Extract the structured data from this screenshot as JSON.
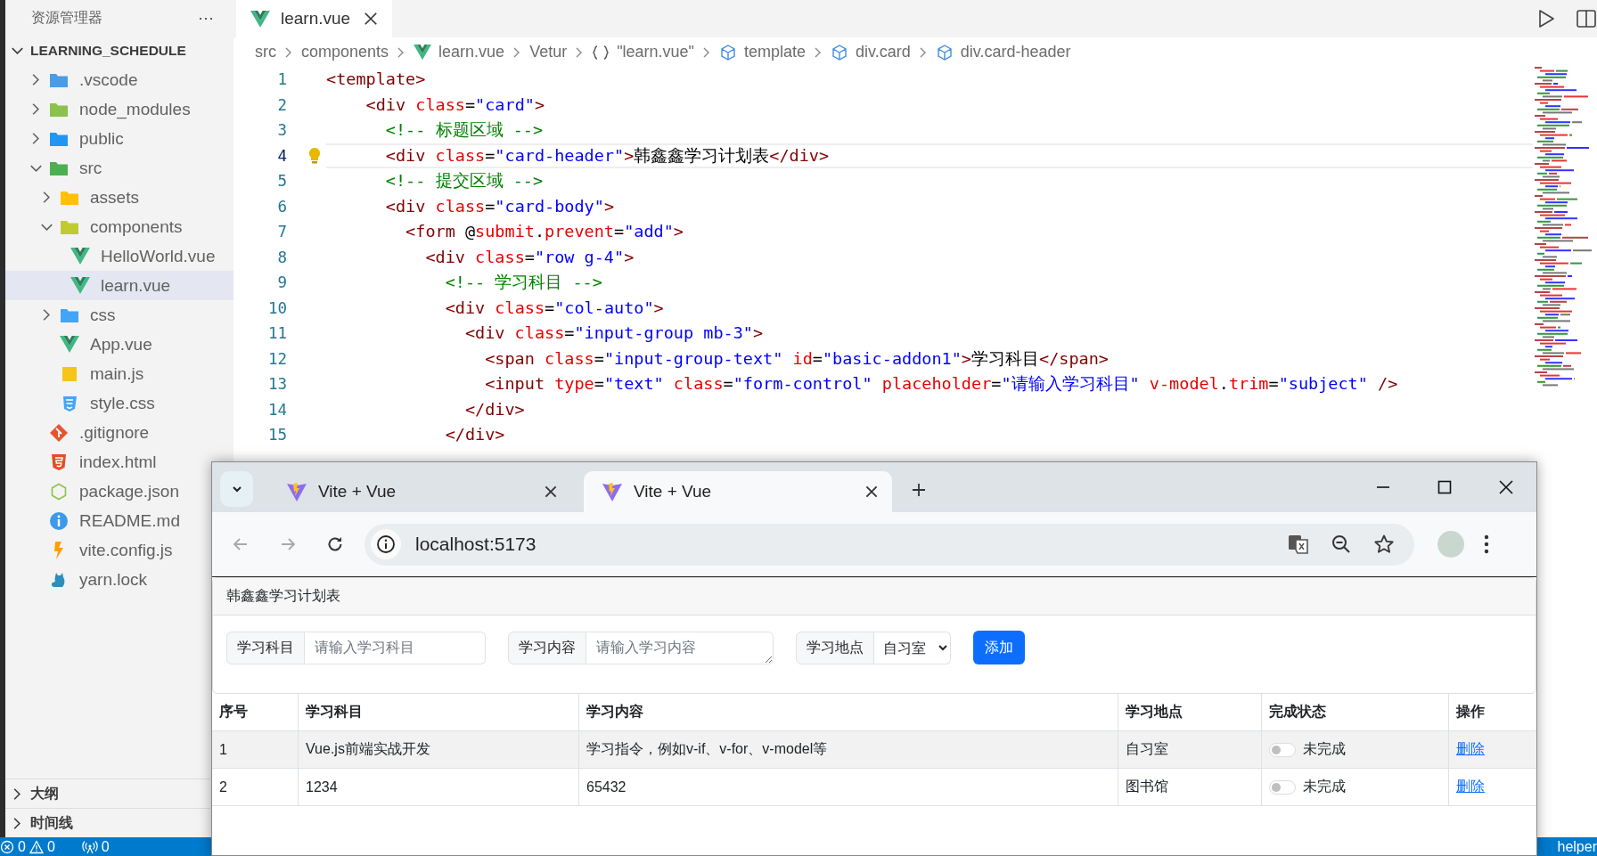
{
  "explorer": {
    "title": "资源管理器",
    "more": "···",
    "root": {
      "label": "LEARNING_SCHEDULE",
      "expanded": true,
      "children": [
        {
          "label": ".vscode",
          "kind": "folder",
          "color": "#4a9be8",
          "expanded": false,
          "selected": false
        },
        {
          "label": "node_modules",
          "kind": "folder",
          "color": "#8bc34a",
          "expanded": false,
          "selected": false
        },
        {
          "label": "public",
          "kind": "folder",
          "color": "#2196f3",
          "expanded": false,
          "selected": false
        },
        {
          "label": "src",
          "kind": "folder",
          "color": "#4caf50",
          "expanded": true,
          "selected": false,
          "children": [
            {
              "label": "assets",
              "kind": "folder",
              "color": "#ffc107",
              "expanded": false,
              "selected": false
            },
            {
              "label": "components",
              "kind": "folder",
              "color": "#c0ca33",
              "expanded": true,
              "selected": false,
              "children": [
                {
                  "label": "HelloWorld.vue",
                  "kind": "vue",
                  "selected": false
                },
                {
                  "label": "learn.vue",
                  "kind": "vue",
                  "selected": true
                }
              ]
            },
            {
              "label": "css",
              "kind": "folder",
              "color": "#42a5f5",
              "expanded": false,
              "selected": false
            },
            {
              "label": "App.vue",
              "kind": "vue",
              "selected": false
            },
            {
              "label": "main.js",
              "kind": "script",
              "selected": false
            },
            {
              "label": "style.css",
              "kind": "stylesheet",
              "selected": false
            }
          ]
        },
        {
          "label": ".gitignore",
          "kind": "git",
          "selected": false
        },
        {
          "label": "index.html",
          "kind": "html",
          "selected": false
        },
        {
          "label": "package.json",
          "kind": "json",
          "selected": false
        },
        {
          "label": "README.md",
          "kind": "readme",
          "selected": false
        },
        {
          "label": "vite.config.js",
          "kind": "config",
          "selected": false
        },
        {
          "label": "yarn.lock",
          "kind": "lock",
          "selected": false
        }
      ]
    },
    "sections": [
      {
        "label": "大纲",
        "expanded": false
      },
      {
        "label": "时间线",
        "expanded": false
      }
    ]
  },
  "editor": {
    "tabs": [
      {
        "label": "learn.vue",
        "kind": "vue",
        "selected": true
      }
    ],
    "breadcrumbs": [
      {
        "label": "src",
        "kind": "plain"
      },
      {
        "label": "components",
        "kind": "plain"
      },
      {
        "label": "learn.vue",
        "kind": "vue"
      },
      {
        "label": "Vetur",
        "kind": "plain"
      },
      {
        "label": "\"learn.vue\"",
        "kind": "module"
      },
      {
        "label": "template",
        "kind": "element"
      },
      {
        "label": "div.card",
        "kind": "element"
      },
      {
        "label": "div.card-header",
        "kind": "element"
      }
    ],
    "lines": [
      {
        "number": "1",
        "active": false,
        "tokens": [
          {
            "kind": "tag",
            "text": "<template>"
          }
        ]
      },
      {
        "number": "2",
        "active": false,
        "tokens": [
          {
            "kind": "tag",
            "text": "    <div"
          },
          {
            "kind": "attr",
            "text": " class"
          },
          {
            "kind": "plain",
            "text": "="
          },
          {
            "kind": "str",
            "text": "\"card\""
          },
          {
            "kind": "tag",
            "text": ">"
          }
        ]
      },
      {
        "number": "3",
        "active": false,
        "tokens": [
          {
            "kind": "comment",
            "text": "      <!-- 标题区域 -->"
          }
        ]
      },
      {
        "number": "4",
        "active": true,
        "tokens": [
          {
            "kind": "tag",
            "text": "      <div"
          },
          {
            "kind": "attr",
            "text": " class"
          },
          {
            "kind": "plain",
            "text": "="
          },
          {
            "kind": "str",
            "text": "\"card-header\""
          },
          {
            "kind": "tag",
            "text": ">"
          },
          {
            "kind": "plain",
            "text": "韩鑫鑫学习计划表"
          },
          {
            "kind": "tag",
            "text": "</div>"
          }
        ]
      },
      {
        "number": "5",
        "active": false,
        "tokens": [
          {
            "kind": "comment",
            "text": "      <!-- 提交区域 -->"
          }
        ]
      },
      {
        "number": "6",
        "active": false,
        "tokens": [
          {
            "kind": "tag",
            "text": "      <div"
          },
          {
            "kind": "attr",
            "text": " class"
          },
          {
            "kind": "plain",
            "text": "="
          },
          {
            "kind": "str",
            "text": "\"card-body\""
          },
          {
            "kind": "tag",
            "text": ">"
          }
        ]
      },
      {
        "number": "7",
        "active": false,
        "tokens": [
          {
            "kind": "tag",
            "text": "        <form"
          },
          {
            "kind": "plain",
            "text": " @"
          },
          {
            "kind": "attr",
            "text": "submit"
          },
          {
            "kind": "plain",
            "text": "."
          },
          {
            "kind": "attr",
            "text": "prevent"
          },
          {
            "kind": "plain",
            "text": "="
          },
          {
            "kind": "str",
            "text": "\"add\""
          },
          {
            "kind": "tag",
            "text": ">"
          }
        ]
      },
      {
        "number": "8",
        "active": false,
        "tokens": [
          {
            "kind": "tag",
            "text": "          <div"
          },
          {
            "kind": "attr",
            "text": " class"
          },
          {
            "kind": "plain",
            "text": "="
          },
          {
            "kind": "str",
            "text": "\"row g-4\""
          },
          {
            "kind": "tag",
            "text": ">"
          }
        ]
      },
      {
        "number": "9",
        "active": false,
        "tokens": [
          {
            "kind": "comment",
            "text": "            <!-- 学习科目 -->"
          }
        ]
      },
      {
        "number": "10",
        "active": false,
        "tokens": [
          {
            "kind": "tag",
            "text": "            <div"
          },
          {
            "kind": "attr",
            "text": " class"
          },
          {
            "kind": "plain",
            "text": "="
          },
          {
            "kind": "str",
            "text": "\"col-auto\""
          },
          {
            "kind": "tag",
            "text": ">"
          }
        ]
      },
      {
        "number": "11",
        "active": false,
        "tokens": [
          {
            "kind": "tag",
            "text": "              <div"
          },
          {
            "kind": "attr",
            "text": " class"
          },
          {
            "kind": "plain",
            "text": "="
          },
          {
            "kind": "str",
            "text": "\"input-group mb-3\""
          },
          {
            "kind": "tag",
            "text": ">"
          }
        ]
      },
      {
        "number": "12",
        "active": false,
        "tokens": [
          {
            "kind": "tag",
            "text": "                <span"
          },
          {
            "kind": "attr",
            "text": " class"
          },
          {
            "kind": "plain",
            "text": "="
          },
          {
            "kind": "str",
            "text": "\"input-group-text\""
          },
          {
            "kind": "attr",
            "text": " id"
          },
          {
            "kind": "plain",
            "text": "="
          },
          {
            "kind": "str",
            "text": "\"basic-addon1\""
          },
          {
            "kind": "tag",
            "text": ">"
          },
          {
            "kind": "plain",
            "text": "学习科目"
          },
          {
            "kind": "tag",
            "text": "</span>"
          }
        ]
      },
      {
        "number": "13",
        "active": false,
        "tokens": [
          {
            "kind": "tag",
            "text": "                <input"
          },
          {
            "kind": "attr",
            "text": " type"
          },
          {
            "kind": "plain",
            "text": "="
          },
          {
            "kind": "str",
            "text": "\"text\""
          },
          {
            "kind": "attr",
            "text": " class"
          },
          {
            "kind": "plain",
            "text": "="
          },
          {
            "kind": "str",
            "text": "\"form-control\""
          },
          {
            "kind": "attr",
            "text": " placeholder"
          },
          {
            "kind": "plain",
            "text": "="
          },
          {
            "kind": "str",
            "text": "\"请输入学习科目\""
          },
          {
            "kind": "attr",
            "text": " v-model"
          },
          {
            "kind": "plain",
            "text": "."
          },
          {
            "kind": "attr",
            "text": "trim"
          },
          {
            "kind": "plain",
            "text": "="
          },
          {
            "kind": "str",
            "text": "\"subject\""
          },
          {
            "kind": "tag",
            "text": " />"
          }
        ]
      },
      {
        "number": "14",
        "active": false,
        "tokens": [
          {
            "kind": "tag",
            "text": "              </div>"
          }
        ]
      },
      {
        "number": "15",
        "active": false,
        "tokens": [
          {
            "kind": "tag",
            "text": "            </div>"
          }
        ]
      }
    ]
  },
  "status_bar": {
    "errors": "0",
    "warnings": "0",
    "ports": "0",
    "right_text": "helper"
  },
  "browser": {
    "tabs": [
      {
        "title": "Vite + Vue",
        "selected": false
      },
      {
        "title": "Vite + Vue",
        "selected": true
      }
    ],
    "back": {
      "disabled": true
    },
    "forward": {
      "disabled": true
    },
    "address": "localhost:5173",
    "page": {
      "card_title": "韩鑫鑫学习计划表",
      "fields": [
        {
          "kind": "input",
          "label": "学习科目",
          "placeholder": "请输入学习科目"
        },
        {
          "kind": "textarea",
          "label": "学习内容",
          "placeholder": "请输入学习内容"
        },
        {
          "kind": "select",
          "label": "学习地点",
          "value": "自习室"
        }
      ],
      "submit": "添加",
      "table": {
        "columns": [
          "序号",
          "学习科目",
          "学习内容",
          "学习地点",
          "完成状态",
          "操作"
        ],
        "rows": [
          {
            "index": "1",
            "subject": "Vue.js前端实战开发",
            "content": "学习指令，例如v-if、v-for、v-model等",
            "place": "自习室",
            "done": false,
            "status": "未完成",
            "action": "删除"
          },
          {
            "index": "2",
            "subject": "1234",
            "content": "65432",
            "place": "图书馆",
            "done": false,
            "status": "未完成",
            "action": "删除"
          }
        ]
      }
    }
  }
}
